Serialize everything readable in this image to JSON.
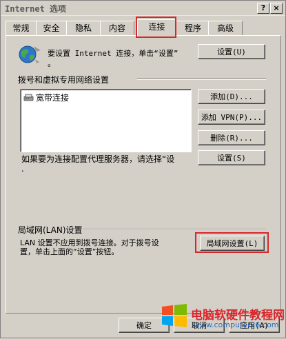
{
  "window": {
    "title": "Internet 选项",
    "help_button": "?",
    "close_button": "×"
  },
  "tabs": [
    {
      "label": "常规"
    },
    {
      "label": "安全"
    },
    {
      "label": "隐私"
    },
    {
      "label": "内容"
    },
    {
      "label": "连接",
      "active": true
    },
    {
      "label": "程序"
    },
    {
      "label": "高级"
    }
  ],
  "connect": {
    "setup_text_line1": "要设置 Internet 连接，单击“设置”",
    "setup_text_line2": "。",
    "setup_button": "设置(U)"
  },
  "dialup": {
    "section_label": "拨号和虚拟专用网络设置",
    "connections": [
      "宽带连接"
    ],
    "add_button": "添加(D)...",
    "add_vpn_button": "添加 VPN(P)...",
    "remove_button": "删除(R)...",
    "proxy_text": "如果要为连接配置代理服务器，请选择“设",
    "settings_button": "设置(S)"
  },
  "lan": {
    "section_label": "局域网(LAN)设置",
    "desc_line1": "LAN 设置不应用到拨号连接。对于拨号设",
    "desc_line2": "置，单击上面的“设置”按钮。",
    "lan_settings_button": "局域网设置(L)"
  },
  "footer": {
    "ok_button": "确定",
    "cancel_button": "取消",
    "apply_button": "应用(A)"
  },
  "watermark": {
    "text": "电脑软硬件教程网",
    "url": "www.computer26.com"
  },
  "colors": {
    "highlight": "#d9262b",
    "face": "#d4d0c8"
  }
}
